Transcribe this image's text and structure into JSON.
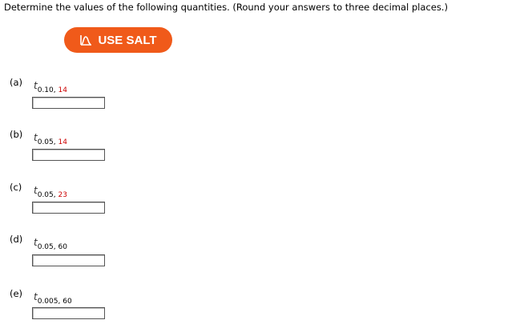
{
  "instructions": "Determine the values of the following quantities. (Round your answers to three decimal places.)",
  "salt_button": {
    "label": "USE SALT",
    "icon": "salt-chart-icon",
    "color": "#f05a1a"
  },
  "parts": [
    {
      "label": "(a)",
      "var": "t",
      "alpha": "0.10",
      "sep": ",",
      "df": "14",
      "df_color": "#cc0000",
      "value": ""
    },
    {
      "label": "(b)",
      "var": "t",
      "alpha": "0.05",
      "sep": ",",
      "df": "14",
      "df_color": "#cc0000",
      "value": ""
    },
    {
      "label": "(c)",
      "var": "t",
      "alpha": "0.05",
      "sep": ",",
      "df": "23",
      "df_color": "#cc0000",
      "value": ""
    },
    {
      "label": "(d)",
      "var": "t",
      "alpha": "0.05",
      "sep": ",",
      "df": "60",
      "df_color": "#000000",
      "value": ""
    },
    {
      "label": "(e)",
      "var": "t",
      "alpha": "0.005",
      "sep": ",",
      "df": "60",
      "df_color": "#000000",
      "value": ""
    }
  ]
}
